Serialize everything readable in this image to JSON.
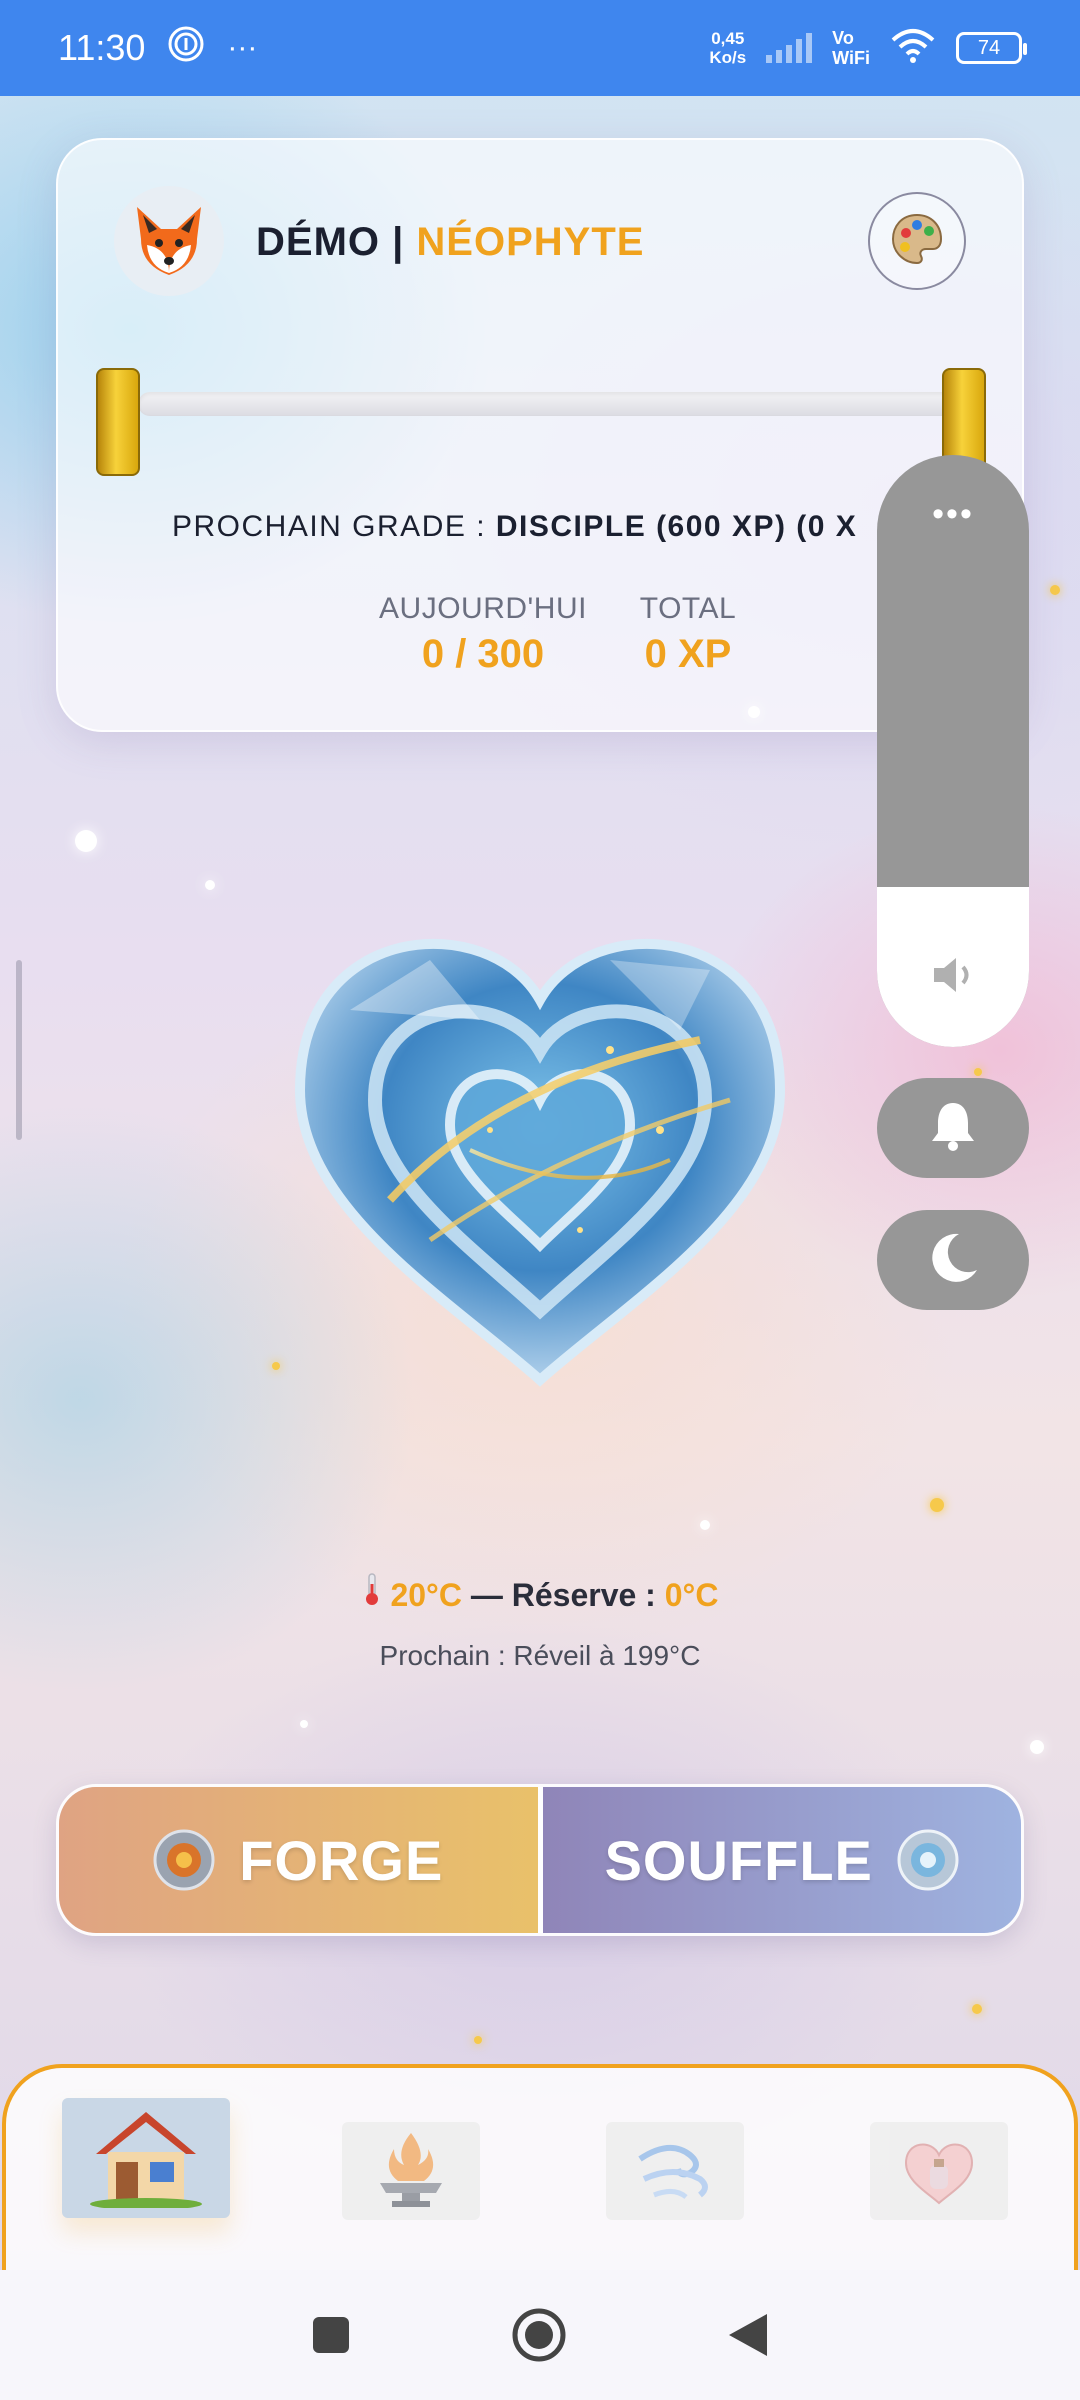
{
  "status_bar": {
    "time": "11:30",
    "more": "···",
    "speed_value": "0,45",
    "speed_unit": "Ko/s",
    "vowifi_line1": "Vo",
    "vowifi_line2": "WiFi",
    "battery": "74"
  },
  "profile": {
    "name": "DÉMO",
    "separator": " | ",
    "grade": "NÉOPHYTE",
    "progress": 0,
    "next_grade_prefix": "PROCHAIN GRADE : ",
    "next_grade_value": "DISCIPLE (600 XP) (0 X",
    "today_label": "AUJOURD'HUI",
    "today_value": "0 / 300",
    "total_label": "TOTAL",
    "total_value": "0 XP"
  },
  "volume_panel": {
    "menu": "•••",
    "level": 0.27
  },
  "temperature": {
    "current": "20°C",
    "separator": " — Réserve : ",
    "reserve": "0°C",
    "next": "Prochain : Réveil à 199°C"
  },
  "actions": {
    "forge": "FORGE",
    "souffle": "SOUFFLE"
  },
  "colors": {
    "accent": "#f0a21e",
    "status_bar": "#3f86ee",
    "overlay_grey": "#979797"
  },
  "icons": {
    "avatar": "fox-icon",
    "palette": "palette-icon",
    "volume": "speaker-icon",
    "bell": "bell-icon",
    "moon": "moon-icon",
    "nav": [
      "house-icon",
      "anvil-fire-icon",
      "wind-swirl-icon",
      "heart-potion-icon"
    ]
  }
}
